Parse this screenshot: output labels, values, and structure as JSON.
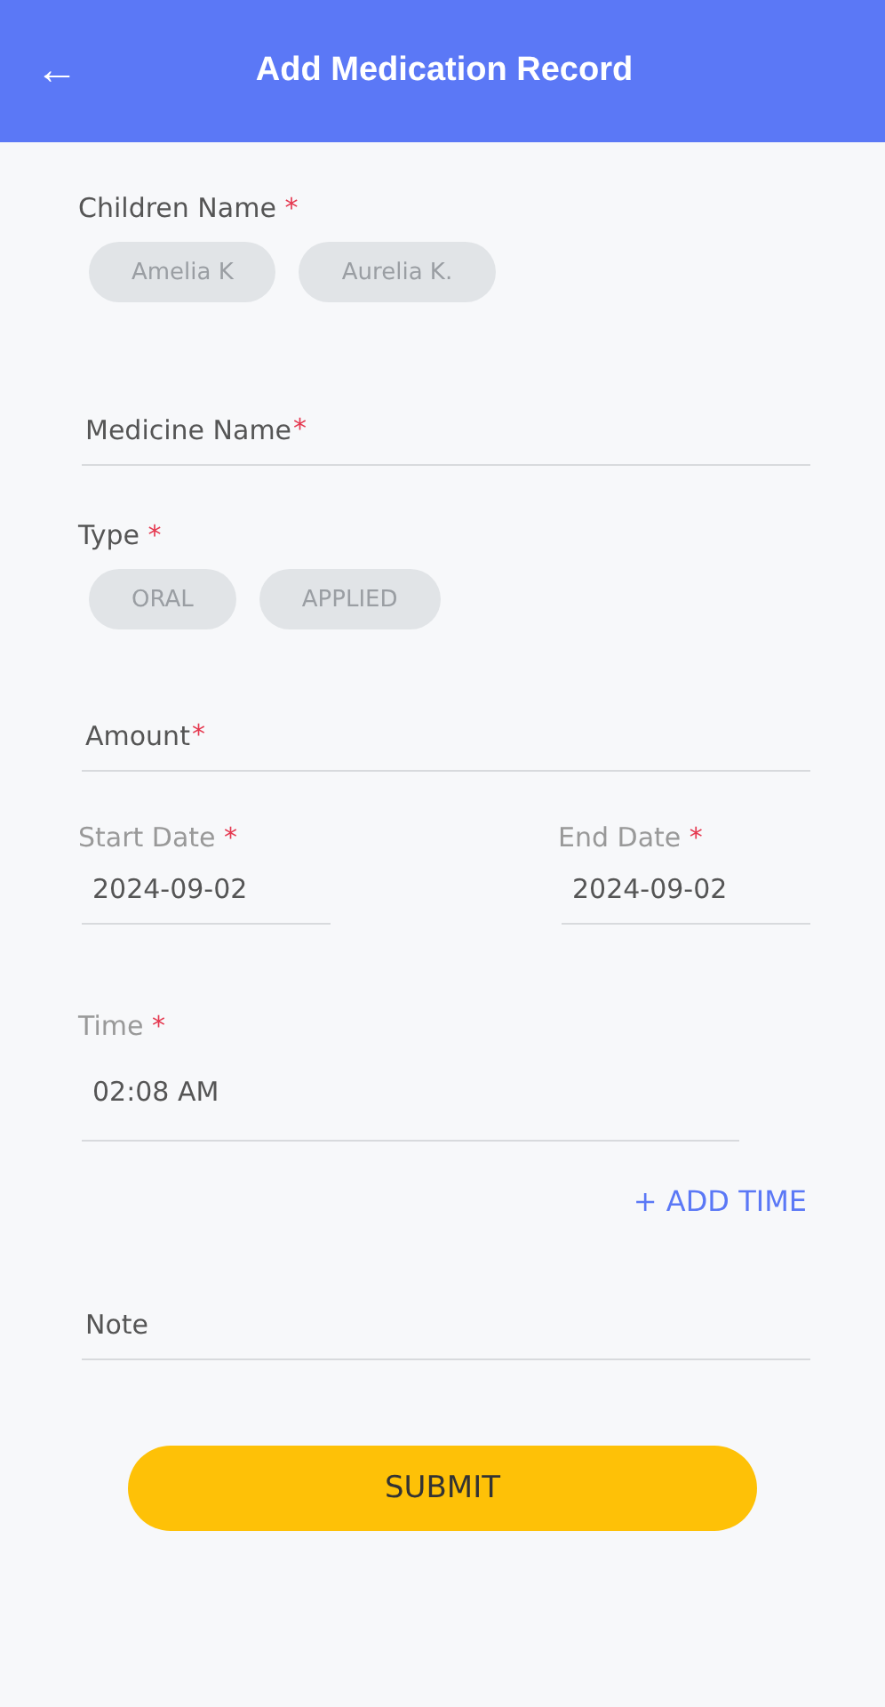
{
  "header": {
    "back_icon": "←",
    "title": "Add Medication Record"
  },
  "children": {
    "label": "Children Name",
    "mark": "*",
    "options": [
      {
        "label": "Amelia K",
        "selected": false
      },
      {
        "label": "Aurelia K.",
        "selected": false
      }
    ]
  },
  "medicine": {
    "placeholder": "Medicine Name",
    "mark": "*"
  },
  "type": {
    "label": "Type",
    "mark": "*",
    "options": [
      {
        "label": "ORAL",
        "selected": false
      },
      {
        "label": "APPLIED",
        "selected": false
      }
    ]
  },
  "amount": {
    "placeholder": "Amount",
    "mark": "*"
  },
  "start_date": {
    "label": "Start Date",
    "mark": "*",
    "value": "2024-09-02"
  },
  "end_date": {
    "label": "End Date",
    "mark": "*",
    "value": "2024-09-02"
  },
  "time": {
    "label": "Time",
    "mark": "*",
    "value": "02:08 AM"
  },
  "add_time": "+ ADD TIME",
  "note": {
    "placeholder": "Note"
  },
  "submit": "SUBMIT"
}
